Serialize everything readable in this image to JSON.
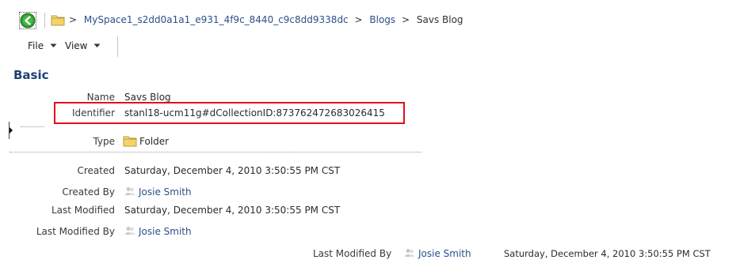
{
  "breadcrumb": {
    "sep": ">",
    "items": [
      "MySpace1_s2dd0a1a1_e931_4f9c_8440_c9c8dd9338dc",
      "Blogs",
      "Savs Blog"
    ]
  },
  "menu": {
    "file": "File",
    "view": "View"
  },
  "section": {
    "title": "Basic"
  },
  "fields": {
    "name": {
      "label": "Name",
      "value": "Savs Blog"
    },
    "identifier": {
      "label": "Identifier",
      "value": "stanl18-ucm11g#dCollectionID:873762472683026415"
    },
    "type": {
      "label": "Type",
      "value": "Folder"
    },
    "created": {
      "label": "Created",
      "value": "Saturday, December 4, 2010 3:50:55 PM CST"
    },
    "created_by": {
      "label": "Created By",
      "value": "Josie Smith"
    },
    "last_modified": {
      "label": "Last Modified",
      "value": "Saturday, December 4, 2010 3:50:55 PM CST"
    },
    "last_modified_by": {
      "label": "Last Modified By",
      "value": "Josie Smith"
    }
  },
  "footer": {
    "label": "Last Modified By",
    "user": "Josie Smith",
    "date": "Saturday, December 4, 2010 3:50:55 PM CST"
  },
  "colors": {
    "link": "#2b4f89",
    "title": "#1f3f73",
    "highlight_border": "#e0101c",
    "back_button": "#2f9c2f"
  }
}
